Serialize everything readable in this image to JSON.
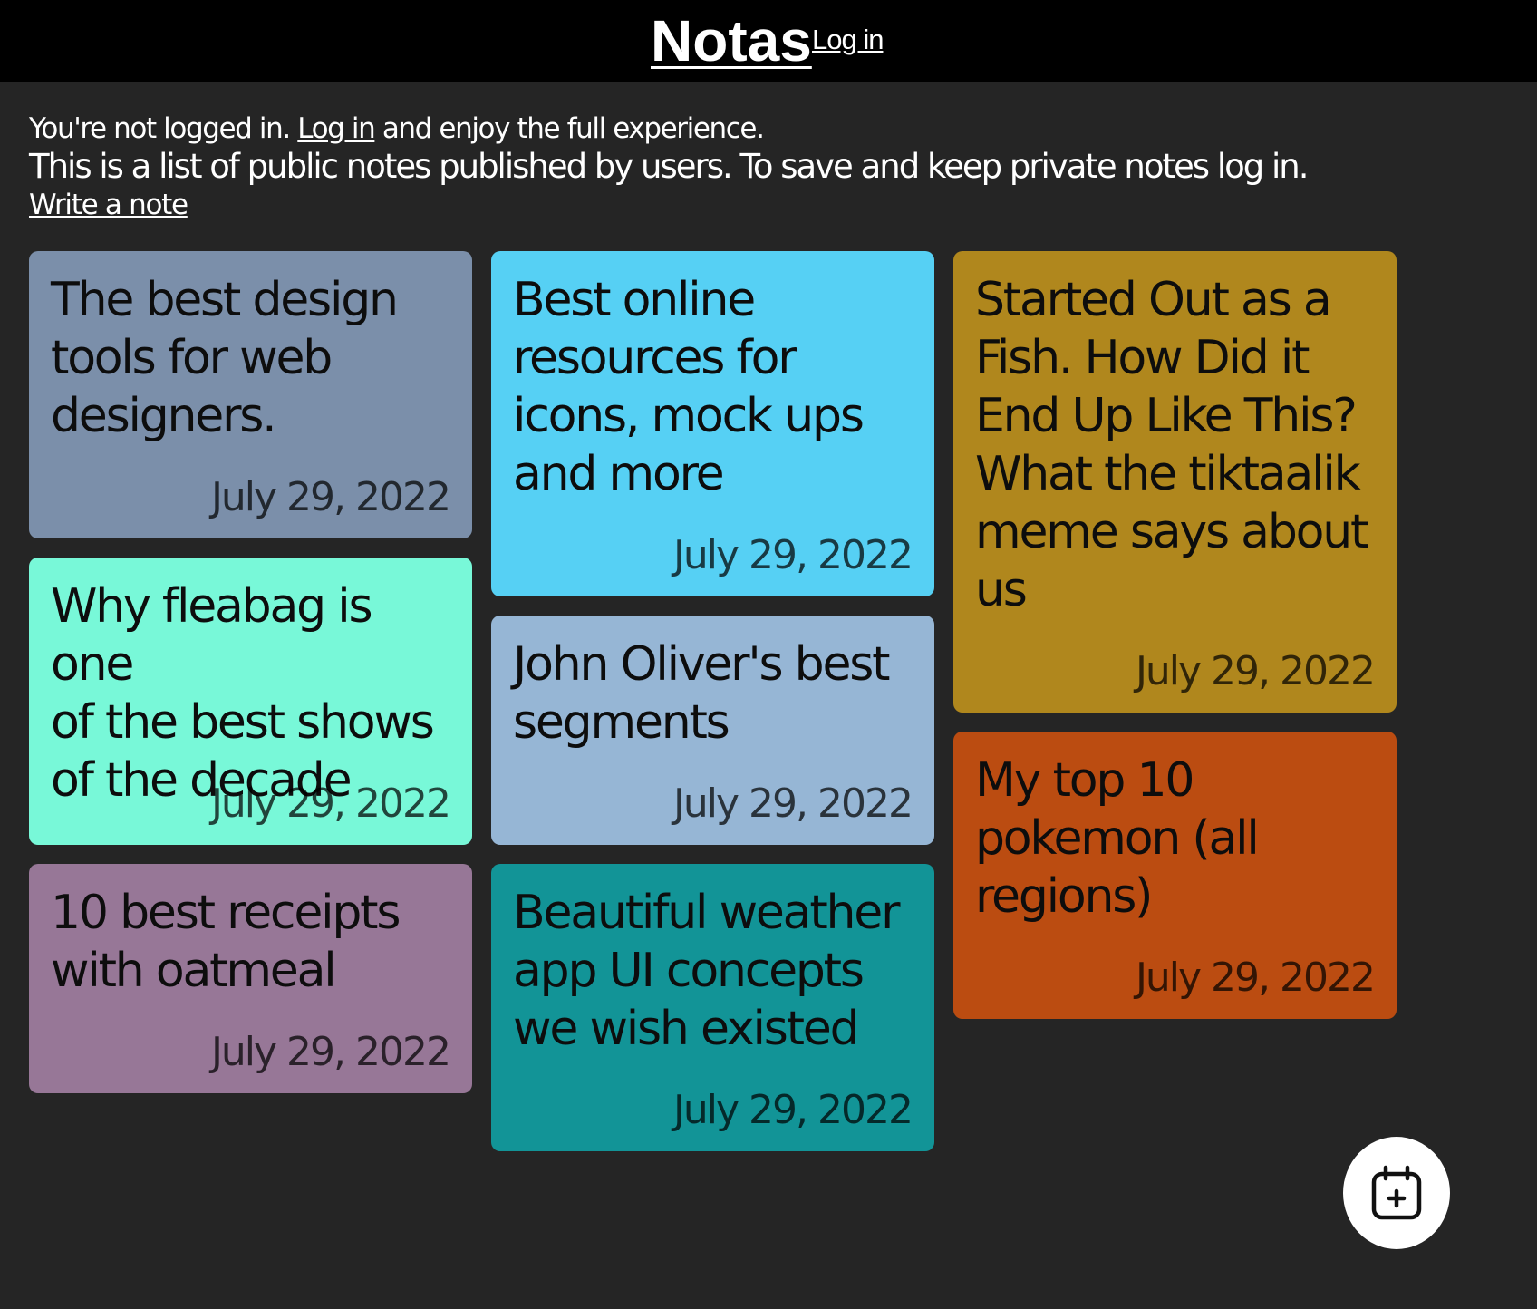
{
  "header": {
    "brand": "Notas",
    "login_label": "Log in"
  },
  "intro": {
    "line1_pre": "You're not logged in. ",
    "line1_link": "Log in",
    "line1_post": " and enjoy the full experience.",
    "line2": "This is a list of public notes published by users. To save and keep private notes log in.",
    "write_note": "Write a note"
  },
  "notes": [
    {
      "title": "The best design\ntools for web\ndesigners.",
      "date": "July 29, 2022",
      "color": "#7b8faa"
    },
    {
      "title": "Best online\nresources for\nicons, mock ups\nand more",
      "date": "July 29, 2022",
      "color": "#56d0f4"
    },
    {
      "title": "Started Out as a\nFish. How Did it\nEnd Up Like This?\nWhat the tiktaalik\nmeme says about\nus",
      "date": "July 29, 2022",
      "color": "#b0871d"
    },
    {
      "title": "Why fleabag is one\nof the best shows\nof the decade",
      "date": "July 29, 2022",
      "color": "#78f8d8"
    },
    {
      "title": "John Oliver's best\nsegments",
      "date": "July 29, 2022",
      "color": "#96b6d5"
    },
    {
      "title": "My top 10\npokemon (all\nregions)",
      "date": "July 29, 2022",
      "color": "#bb4c11"
    },
    {
      "title": "10 best receipts\nwith oatmeal",
      "date": "July 29, 2022",
      "color": "#977797"
    },
    {
      "title": "Beautiful weather\napp UI concepts\nwe wish existed",
      "date": "July 29, 2022",
      "color": "#129497"
    }
  ],
  "fab": {
    "icon": "calendar-add-icon"
  },
  "colors": {
    "header_bg": "#000000",
    "page_bg": "#252525",
    "text": "#ffffff"
  }
}
